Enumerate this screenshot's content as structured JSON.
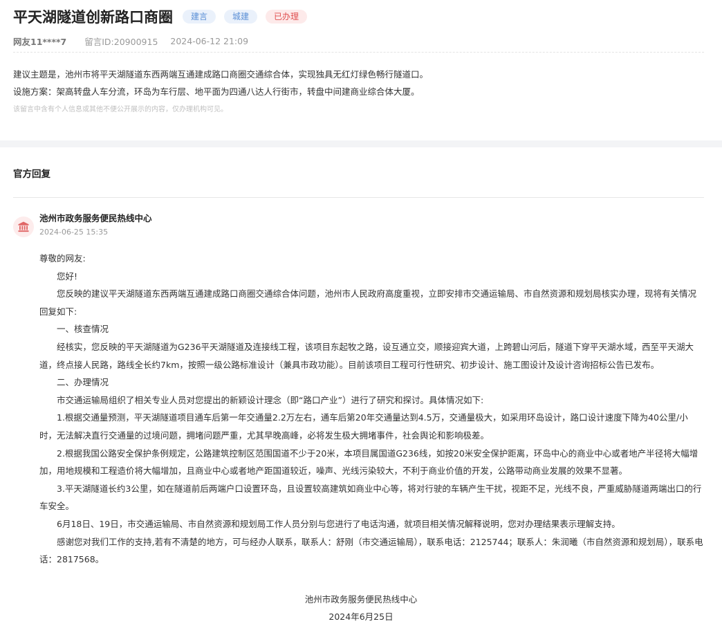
{
  "message": {
    "title": "平天湖隧道创新路口商圈",
    "tags": [
      "建言",
      "城建",
      "已办理"
    ],
    "user": "网友11****7",
    "message_id": "留言ID:20900915",
    "datetime": "2024-06-12 21:09",
    "content_line1": "建议主题是，池州市将平天湖隧道东西两端互通建成路口商圈交通综合体，实现独具无红灯绿色畅行隧道口。",
    "content_line2": "设施方案：架高转盘人车分流，环岛为车行层、地平面为四通八达人行街市，转盘中间建商业综合体大厦。",
    "privacy_note": "该留言中含有个人信息或其他不便公开展示的内容，仅办理机构可见。"
  },
  "reply": {
    "section_title": "官方回复",
    "org_name": "池州市政务服务便民热线中心",
    "org_date": "2024-06-25 15:35",
    "paragraphs": [
      "尊敬的网友:",
      "您好!",
      "您反映的建议平天湖隧道东西两端互通建成路口商圈交通综合体问题，池州市人民政府高度重视，立即安排市交通运输局、市自然资源和规划局核实办理，现将有关情况回复如下:",
      "一、核查情况",
      "经核实，您反映的平天湖隧道为G236平天湖隧道及连接线工程，该项目东起牧之路，设互通立交，顺接迎宾大道，上跨碧山河后，隧道下穿平天湖水域，西至平天湖大道，终点接人民路，路线全长约7km，按照一级公路标准设计（兼具市政功能）。目前该项目工程可行性研究、初步设计、施工图设计及设计咨询招标公告已发布。",
      "二、办理情况",
      "市交通运输局组织了相关专业人员对您提出的新颖设计理念（即“路口产业”）进行了研究和探讨。具体情况如下:",
      "1.根据交通量预测，平天湖隧道项目通车后第一年交通量2.2万左右，通车后第20年交通量达到4.5万，交通量极大，如采用环岛设计，路口设计速度下降为40公里/小时，无法解决直行交通量的过境问题，拥堵问题严重，尤其早晚高峰，必将发生极大拥堵事件，社会舆论和影响极差。",
      "2.根据我国公路安全保护条例规定，公路建筑控制区范围国道不少于20米，本项目属国道G236线，如按20米安全保护距离，环岛中心的商业中心或者地产半径将大幅增加，用地规模和工程造价将大幅增加，且商业中心或者地产距国道较近，噪声、光线污染较大，不利于商业价值的开发，公路带动商业发展的效果不显著。",
      "3.平天湖隧道长约3公里，如在隧道前后两端户口设置环岛，且设置较高建筑如商业中心等，将对行驶的车辆产生干扰，视距不足，光线不良，严重威胁隧道两端出口的行车安全。",
      "6月18日、19日，市交通运输局、市自然资源和规划局工作人员分别与您进行了电话沟通，就项目相关情况解释说明，您对办理结果表示理解支持。",
      "感谢您对我们工作的支持,若有不清楚的地方，可与经办人联系，联系人：舒刚（市交通运输局），联系电话：2125744；联系人：朱润曦（市自然资源和规划局），联系电话：2817568。"
    ],
    "sign_org": "池州市政务服务便民热线中心",
    "sign_date": "2024年6月25日"
  },
  "icons": {
    "org_icon": "government-building-icon"
  },
  "colors": {
    "tag_blue_bg": "#eaf1fb",
    "tag_blue_text": "#5b8fd6",
    "tag_red_bg": "#fdeaea",
    "tag_red_text": "#e05050",
    "org_icon": "#e06666",
    "section_gap": "#f3f4f6"
  }
}
